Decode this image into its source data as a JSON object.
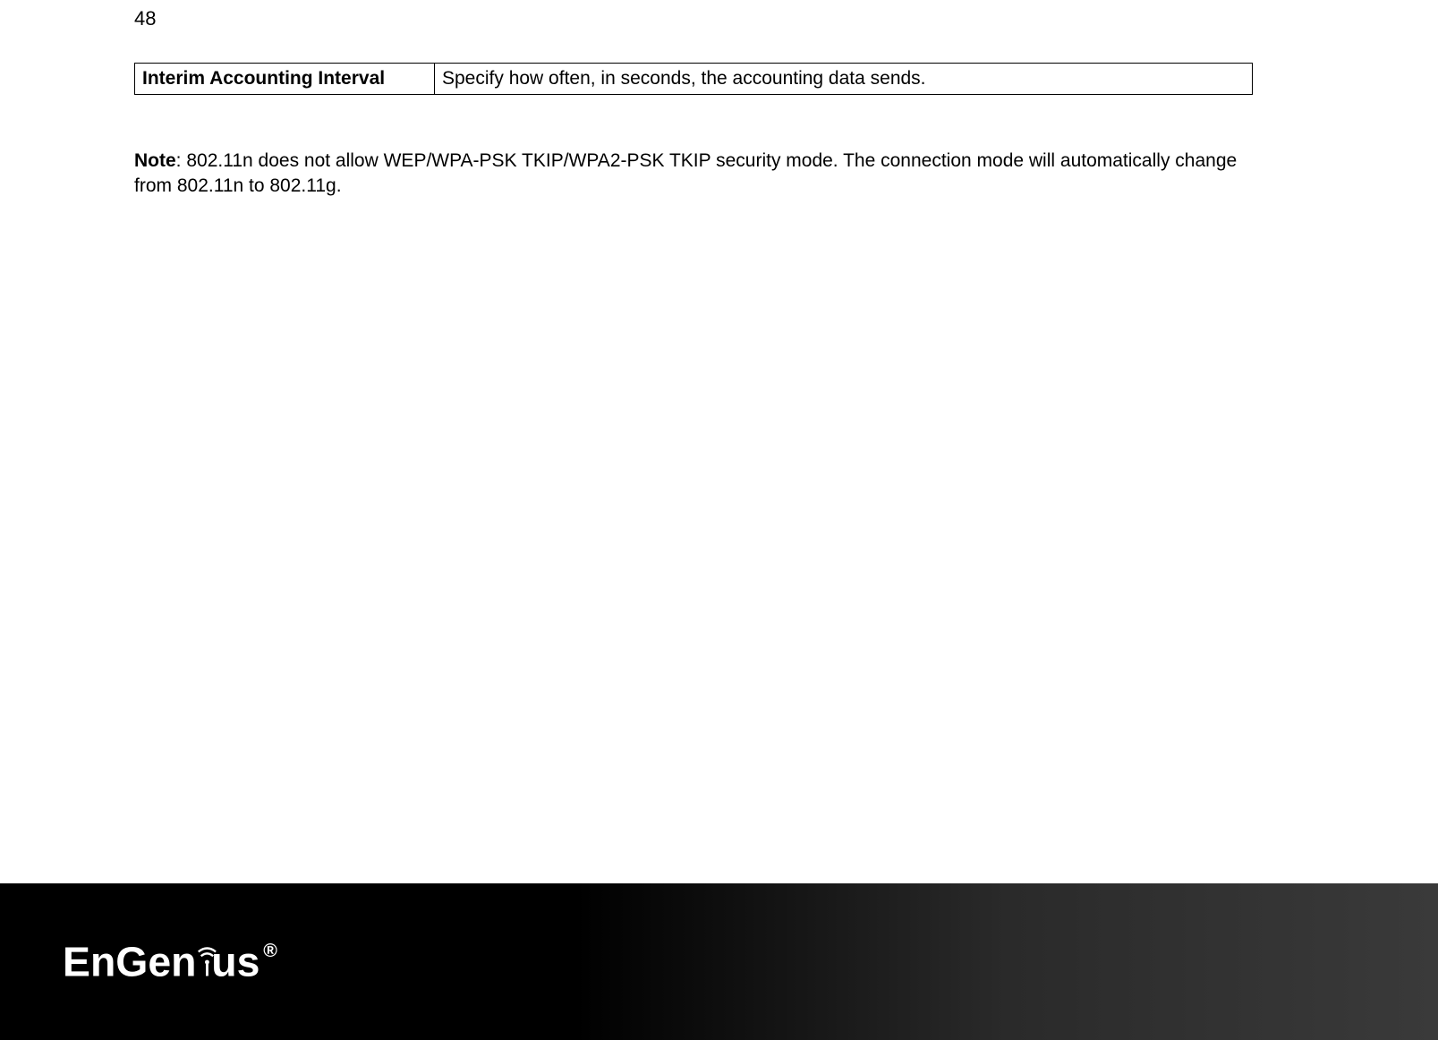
{
  "page_number": "48",
  "table": {
    "label": "Interim Accounting Interval",
    "description": "Specify how often, in seconds, the accounting data sends."
  },
  "note": {
    "label": "Note",
    "text": ":  802.11n does not allow WEP/WPA-PSK TKIP/WPA2-PSK TKIP security mode. The connection mode will automatically change from 802.11n to 802.11g."
  },
  "brand": "EnGenius"
}
